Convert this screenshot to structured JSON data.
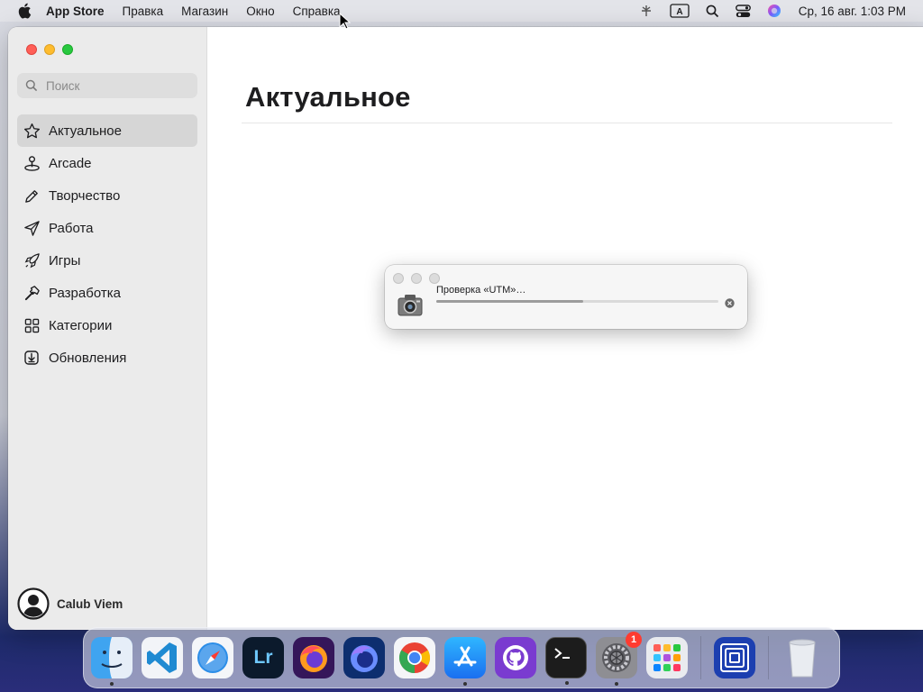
{
  "menubar": {
    "app_name": "App Store",
    "items": [
      "Правка",
      "Магазин",
      "Окно",
      "Справка"
    ],
    "input_source": "A",
    "clock": "Ср, 16 авг. 1:03 PM"
  },
  "sidebar": {
    "search_placeholder": "Поиск",
    "items": [
      {
        "label": "Актуальное",
        "icon": "star-icon",
        "active": true
      },
      {
        "label": "Arcade",
        "icon": "joystick-icon",
        "active": false
      },
      {
        "label": "Творчество",
        "icon": "brush-icon",
        "active": false
      },
      {
        "label": "Работа",
        "icon": "paper-plane-icon",
        "active": false
      },
      {
        "label": "Игры",
        "icon": "rocket-icon",
        "active": false
      },
      {
        "label": "Разработка",
        "icon": "hammer-icon",
        "active": false
      },
      {
        "label": "Категории",
        "icon": "grid-icon",
        "active": false
      },
      {
        "label": "Обновления",
        "icon": "download-icon",
        "active": false
      }
    ],
    "account_name": "Calub Viem"
  },
  "main": {
    "title": "Актуальное"
  },
  "dialog": {
    "message": "Проверка «UTM»…",
    "progress": 0.52
  },
  "dock": {
    "apps": [
      {
        "name": "finder-icon",
        "running": true
      },
      {
        "name": "vscode-icon",
        "running": false
      },
      {
        "name": "safari-icon",
        "running": false
      },
      {
        "name": "lightroom-icon",
        "label": "Lr",
        "running": false
      },
      {
        "name": "firefox-icon",
        "running": false
      },
      {
        "name": "firefox-dev-icon",
        "running": false
      },
      {
        "name": "chrome-icon",
        "running": false
      },
      {
        "name": "app-store-icon",
        "running": true
      },
      {
        "name": "github-desktop-icon",
        "running": false
      },
      {
        "name": "terminal-icon",
        "running": true
      },
      {
        "name": "system-settings-icon",
        "running": true,
        "badge": "1"
      },
      {
        "name": "launchpad-icon",
        "running": false
      },
      {
        "name": "utm-icon",
        "running": false
      },
      {
        "name": "trash-icon",
        "running": false
      }
    ]
  },
  "colors": {
    "sidebar_bg": "#ebebeb",
    "active_item": "#d6d6d6",
    "traffic_red": "#ff5f57",
    "traffic_yellow": "#febc2e",
    "traffic_green": "#28c840",
    "badge": "#ff3b30"
  }
}
